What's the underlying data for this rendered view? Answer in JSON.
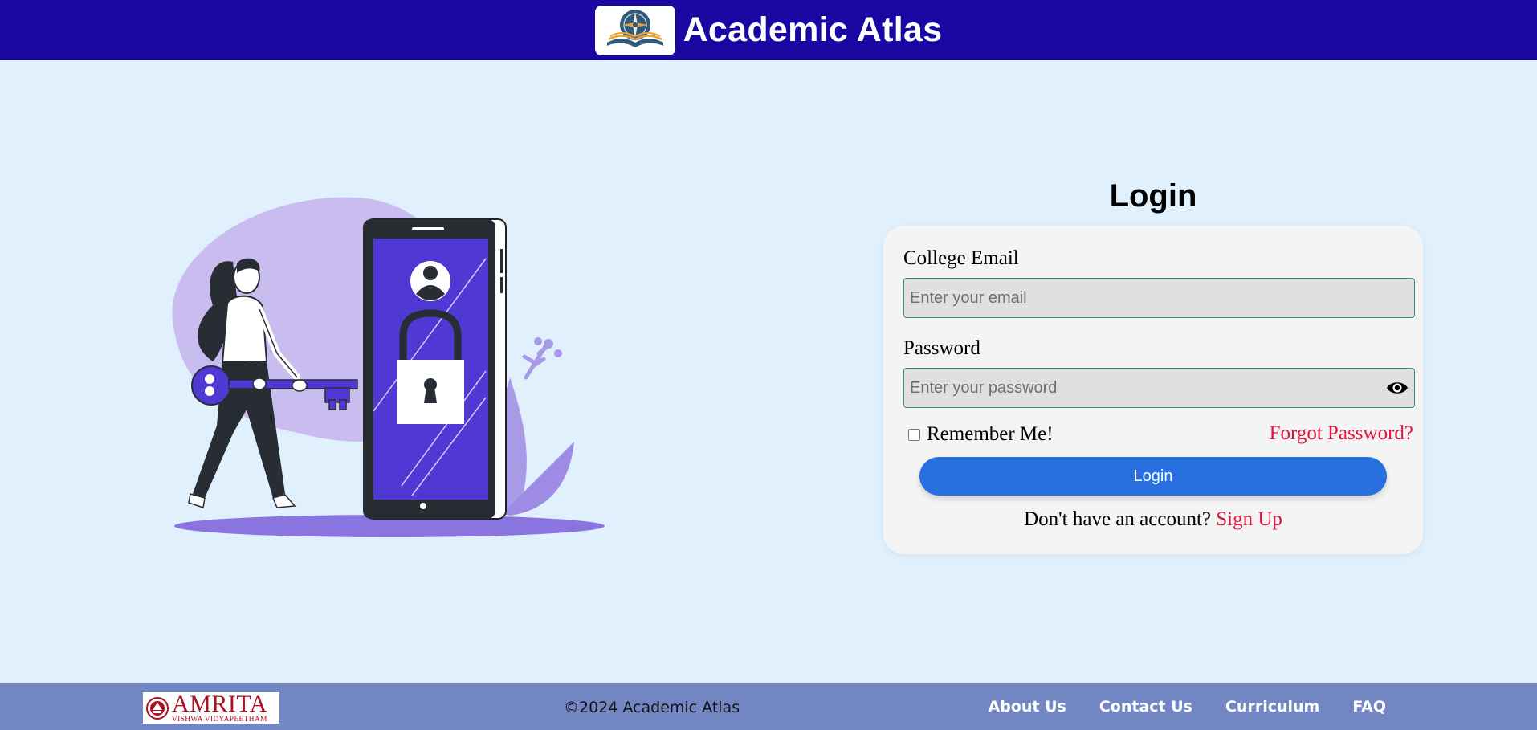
{
  "header": {
    "title": "Academic Atlas",
    "logo_icon": "compass-book-logo-icon",
    "bg_color": "#1a06a0"
  },
  "illustration": {
    "icon": "woman-with-key-phone-lock-illustration"
  },
  "login": {
    "heading": "Login",
    "email_label": "College Email",
    "email_placeholder": "Enter your email",
    "email_value": "",
    "password_label": "Password",
    "password_placeholder": "Enter your password",
    "password_value": "",
    "show_password_icon": "eye-icon",
    "remember_label": "Remember Me!",
    "remember_checked": false,
    "forgot_label": "Forgot Password?",
    "button_label": "Login",
    "no_account_text": "Don't have an account?",
    "signup_label": "Sign Up",
    "accent_color": "#2870e0",
    "link_color": "#e2143c"
  },
  "footer": {
    "logo_name": "AMRITA",
    "logo_sub": "VISHWA VIDYAPEETHAM",
    "copyright": "©2024 Academic Atlas",
    "links": [
      "About Us",
      "Contact Us",
      "Curriculum",
      "FAQ"
    ],
    "bg_color": "#7186c2"
  }
}
